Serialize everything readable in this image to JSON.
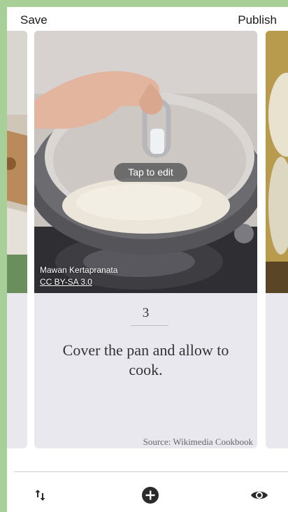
{
  "topbar": {
    "save_label": "Save",
    "publish_label": "Publish"
  },
  "card": {
    "edit_label": "Tap to edit",
    "credit_author": "Mawan Kertapranata",
    "credit_license": "CC BY-SA 3.0",
    "step_number": "3",
    "step_text": "Cover the pan and allow to cook.",
    "source": "Source: Wikimedia Cookbook"
  },
  "bottom_bar": {
    "reorder_icon": "swap-vertical-icon",
    "add_icon": "add-circle-icon",
    "preview_icon": "eye-icon"
  },
  "colors": {
    "frame_green": "#a9cf98",
    "card_bg": "#e9e8ee",
    "icon_dark": "#2b2b2b"
  }
}
